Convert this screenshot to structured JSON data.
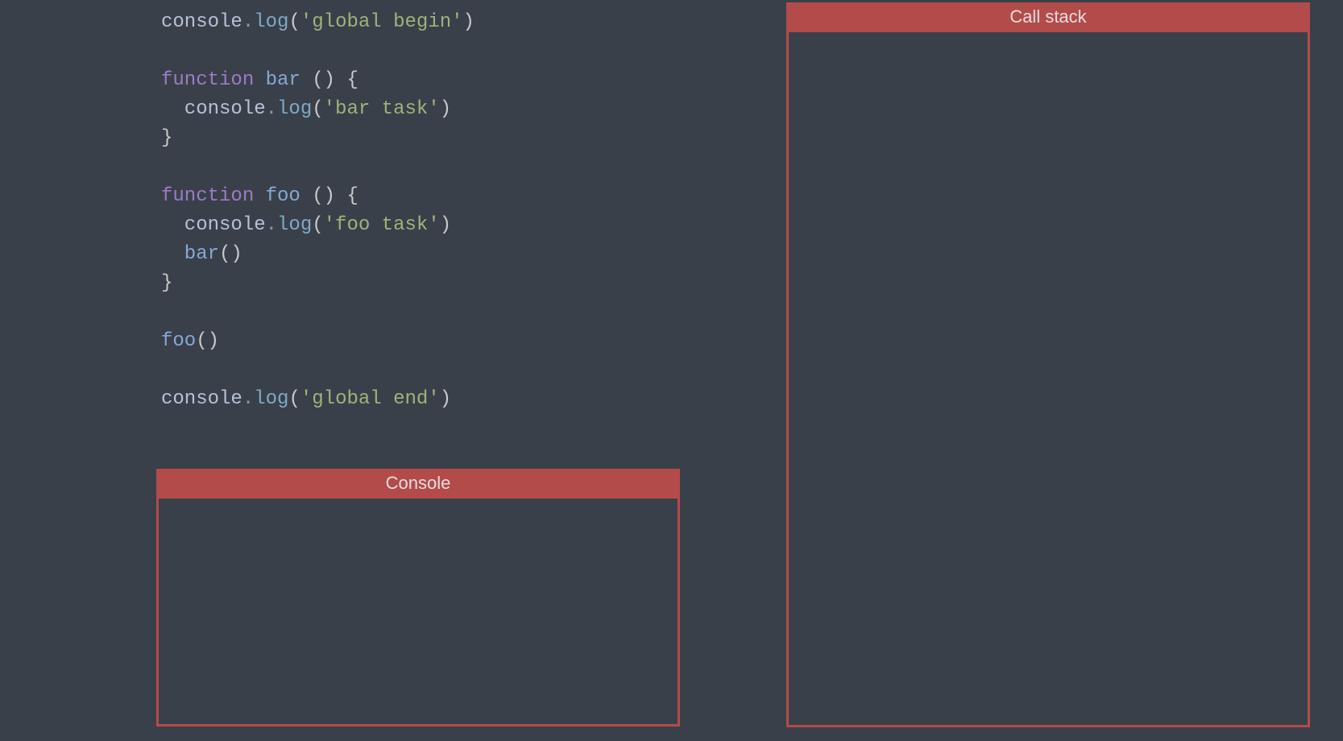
{
  "code": {
    "lines": [
      [
        {
          "cls": "tok-obj",
          "t": "console"
        },
        {
          "cls": "tok-punct",
          "t": "."
        },
        {
          "cls": "tok-method",
          "t": "log"
        },
        {
          "cls": "tok-paren",
          "t": "("
        },
        {
          "cls": "tok-string",
          "t": "'global begin'"
        },
        {
          "cls": "tok-paren",
          "t": ")"
        }
      ],
      [],
      [
        {
          "cls": "tok-keyword",
          "t": "function "
        },
        {
          "cls": "tok-fn",
          "t": "bar "
        },
        {
          "cls": "tok-paren",
          "t": "() "
        },
        {
          "cls": "tok-brace",
          "t": "{"
        }
      ],
      [
        {
          "cls": "tok-obj",
          "t": "  console"
        },
        {
          "cls": "tok-punct",
          "t": "."
        },
        {
          "cls": "tok-method",
          "t": "log"
        },
        {
          "cls": "tok-paren",
          "t": "("
        },
        {
          "cls": "tok-string",
          "t": "'bar task'"
        },
        {
          "cls": "tok-paren",
          "t": ")"
        }
      ],
      [
        {
          "cls": "tok-brace",
          "t": "}"
        }
      ],
      [],
      [
        {
          "cls": "tok-keyword",
          "t": "function "
        },
        {
          "cls": "tok-fn",
          "t": "foo "
        },
        {
          "cls": "tok-paren",
          "t": "() "
        },
        {
          "cls": "tok-brace",
          "t": "{"
        }
      ],
      [
        {
          "cls": "tok-obj",
          "t": "  console"
        },
        {
          "cls": "tok-punct",
          "t": "."
        },
        {
          "cls": "tok-method",
          "t": "log"
        },
        {
          "cls": "tok-paren",
          "t": "("
        },
        {
          "cls": "tok-string",
          "t": "'foo task'"
        },
        {
          "cls": "tok-paren",
          "t": ")"
        }
      ],
      [
        {
          "cls": "tok-fn",
          "t": "  bar"
        },
        {
          "cls": "tok-paren",
          "t": "()"
        }
      ],
      [
        {
          "cls": "tok-brace",
          "t": "}"
        }
      ],
      [],
      [
        {
          "cls": "tok-fn",
          "t": "foo"
        },
        {
          "cls": "tok-paren",
          "t": "()"
        }
      ],
      [],
      [
        {
          "cls": "tok-obj",
          "t": "console"
        },
        {
          "cls": "tok-punct",
          "t": "."
        },
        {
          "cls": "tok-method",
          "t": "log"
        },
        {
          "cls": "tok-paren",
          "t": "("
        },
        {
          "cls": "tok-string",
          "t": "'global end'"
        },
        {
          "cls": "tok-paren",
          "t": ")"
        }
      ]
    ]
  },
  "panels": {
    "console_title": "Console",
    "callstack_title": "Call stack"
  }
}
